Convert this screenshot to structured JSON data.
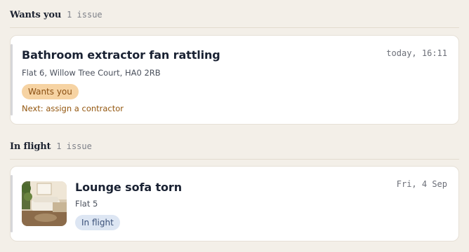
{
  "sections": [
    {
      "title": "Wants you",
      "count": "1 issue",
      "issue": {
        "title": "Bathroom extractor fan rattling",
        "time": "today, 16:11",
        "address": "Flat 6, Willow Tree Court, HA0 2RB",
        "status": "Wants you",
        "next_step": "Next: assign a contractor"
      }
    },
    {
      "title": "In flight",
      "count": "1 issue",
      "issue": {
        "title": "Lounge sofa torn",
        "time": "Fri, 4 Sep",
        "address": "Flat 5",
        "status": "In flight",
        "thumbnail": "lounge-photo"
      }
    }
  ],
  "colors": {
    "background": "#f3efe8",
    "card": "#ffffff",
    "wants_pill_bg": "#f6d3a3",
    "wants_pill_text": "#8a4f12",
    "flight_pill_bg": "#dde6f3",
    "flight_pill_text": "#3a5078",
    "next_step_text": "#93560e"
  }
}
